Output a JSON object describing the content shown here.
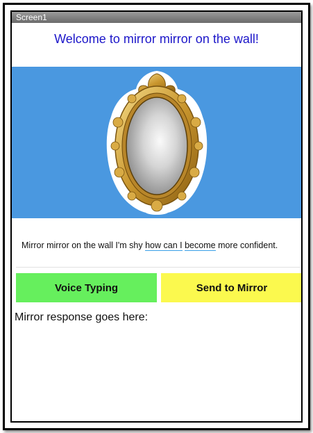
{
  "screen": {
    "title": "Screen1"
  },
  "header": {
    "welcome_text": "Welcome to mirror mirror on the wall!"
  },
  "image": {
    "icon": "ornate-gold-mirror-icon",
    "background_color": "#4a98e0"
  },
  "prompt": {
    "parts": [
      "Mirror mirror on the wall I'm shy ",
      "how can I",
      " ",
      "become",
      " more confident."
    ]
  },
  "buttons": {
    "voice_typing": "Voice Typing",
    "send_to_mirror": "Send to Mirror"
  },
  "response": {
    "text": "Mirror response goes here:"
  },
  "colors": {
    "voice_button": "#66ef5d",
    "send_button": "#fbf94e",
    "title_text": "#1c16c9"
  }
}
